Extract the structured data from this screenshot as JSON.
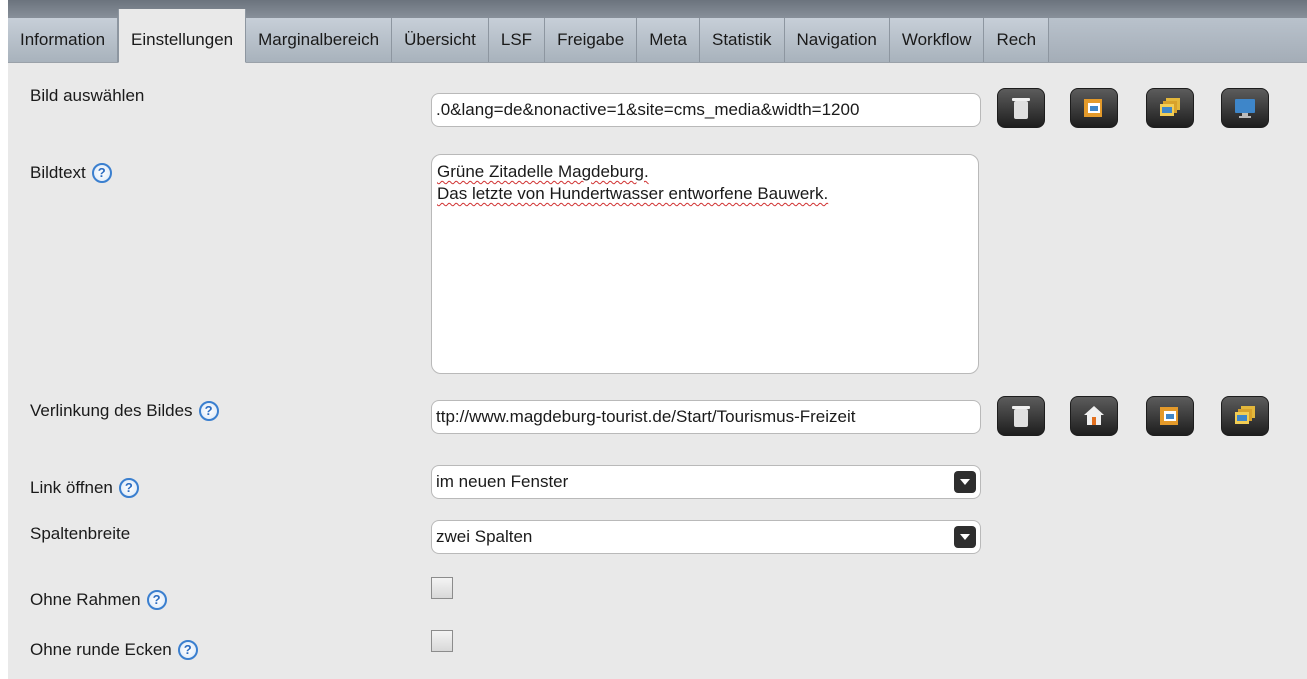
{
  "tabs": [
    {
      "label": "Information",
      "active": false
    },
    {
      "label": "Einstellungen",
      "active": true
    },
    {
      "label": "Marginalbereich",
      "active": false
    },
    {
      "label": "Übersicht",
      "active": false
    },
    {
      "label": "LSF",
      "active": false
    },
    {
      "label": "Freigabe",
      "active": false
    },
    {
      "label": "Meta",
      "active": false
    },
    {
      "label": "Statistik",
      "active": false
    },
    {
      "label": "Navigation",
      "active": false
    },
    {
      "label": "Workflow",
      "active": false
    },
    {
      "label": "Rech",
      "active": false
    }
  ],
  "form": {
    "bild": {
      "label": "Bild auswählen",
      "value": ".0&lang=de&nonactive=1&site=cms_media&width=1200",
      "buttons": [
        "trash-icon",
        "folder-image-icon",
        "gallery-icon",
        "monitor-icon"
      ]
    },
    "bildtext": {
      "label": "Bildtext",
      "help": "?",
      "line1": "Grüne Zitadelle Magdeburg.",
      "line2": "Das letzte von Hundertwasser entworfene Bauwerk."
    },
    "verlinkung": {
      "label": "Verlinkung des Bildes",
      "help": "?",
      "value": "ttp://www.magdeburg-tourist.de/Start/Tourismus-Freizeit",
      "buttons": [
        "trash-icon",
        "home-icon",
        "folder-image-icon",
        "gallery-icon"
      ]
    },
    "link_oeffnen": {
      "label": "Link öffnen",
      "help": "?",
      "selected": "im neuen Fenster"
    },
    "spaltenbreite": {
      "label": "Spaltenbreite",
      "selected": "zwei Spalten"
    },
    "ohne_rahmen": {
      "label": "Ohne Rahmen",
      "help": "?",
      "checked": false
    },
    "ohne_runde_ecken": {
      "label": "Ohne runde Ecken",
      "help": "?",
      "checked": false
    }
  },
  "colors": {
    "accent": "#3a7fcf",
    "tab_bg": "#b9c2cc",
    "panel_bg": "#e9e9e9"
  }
}
